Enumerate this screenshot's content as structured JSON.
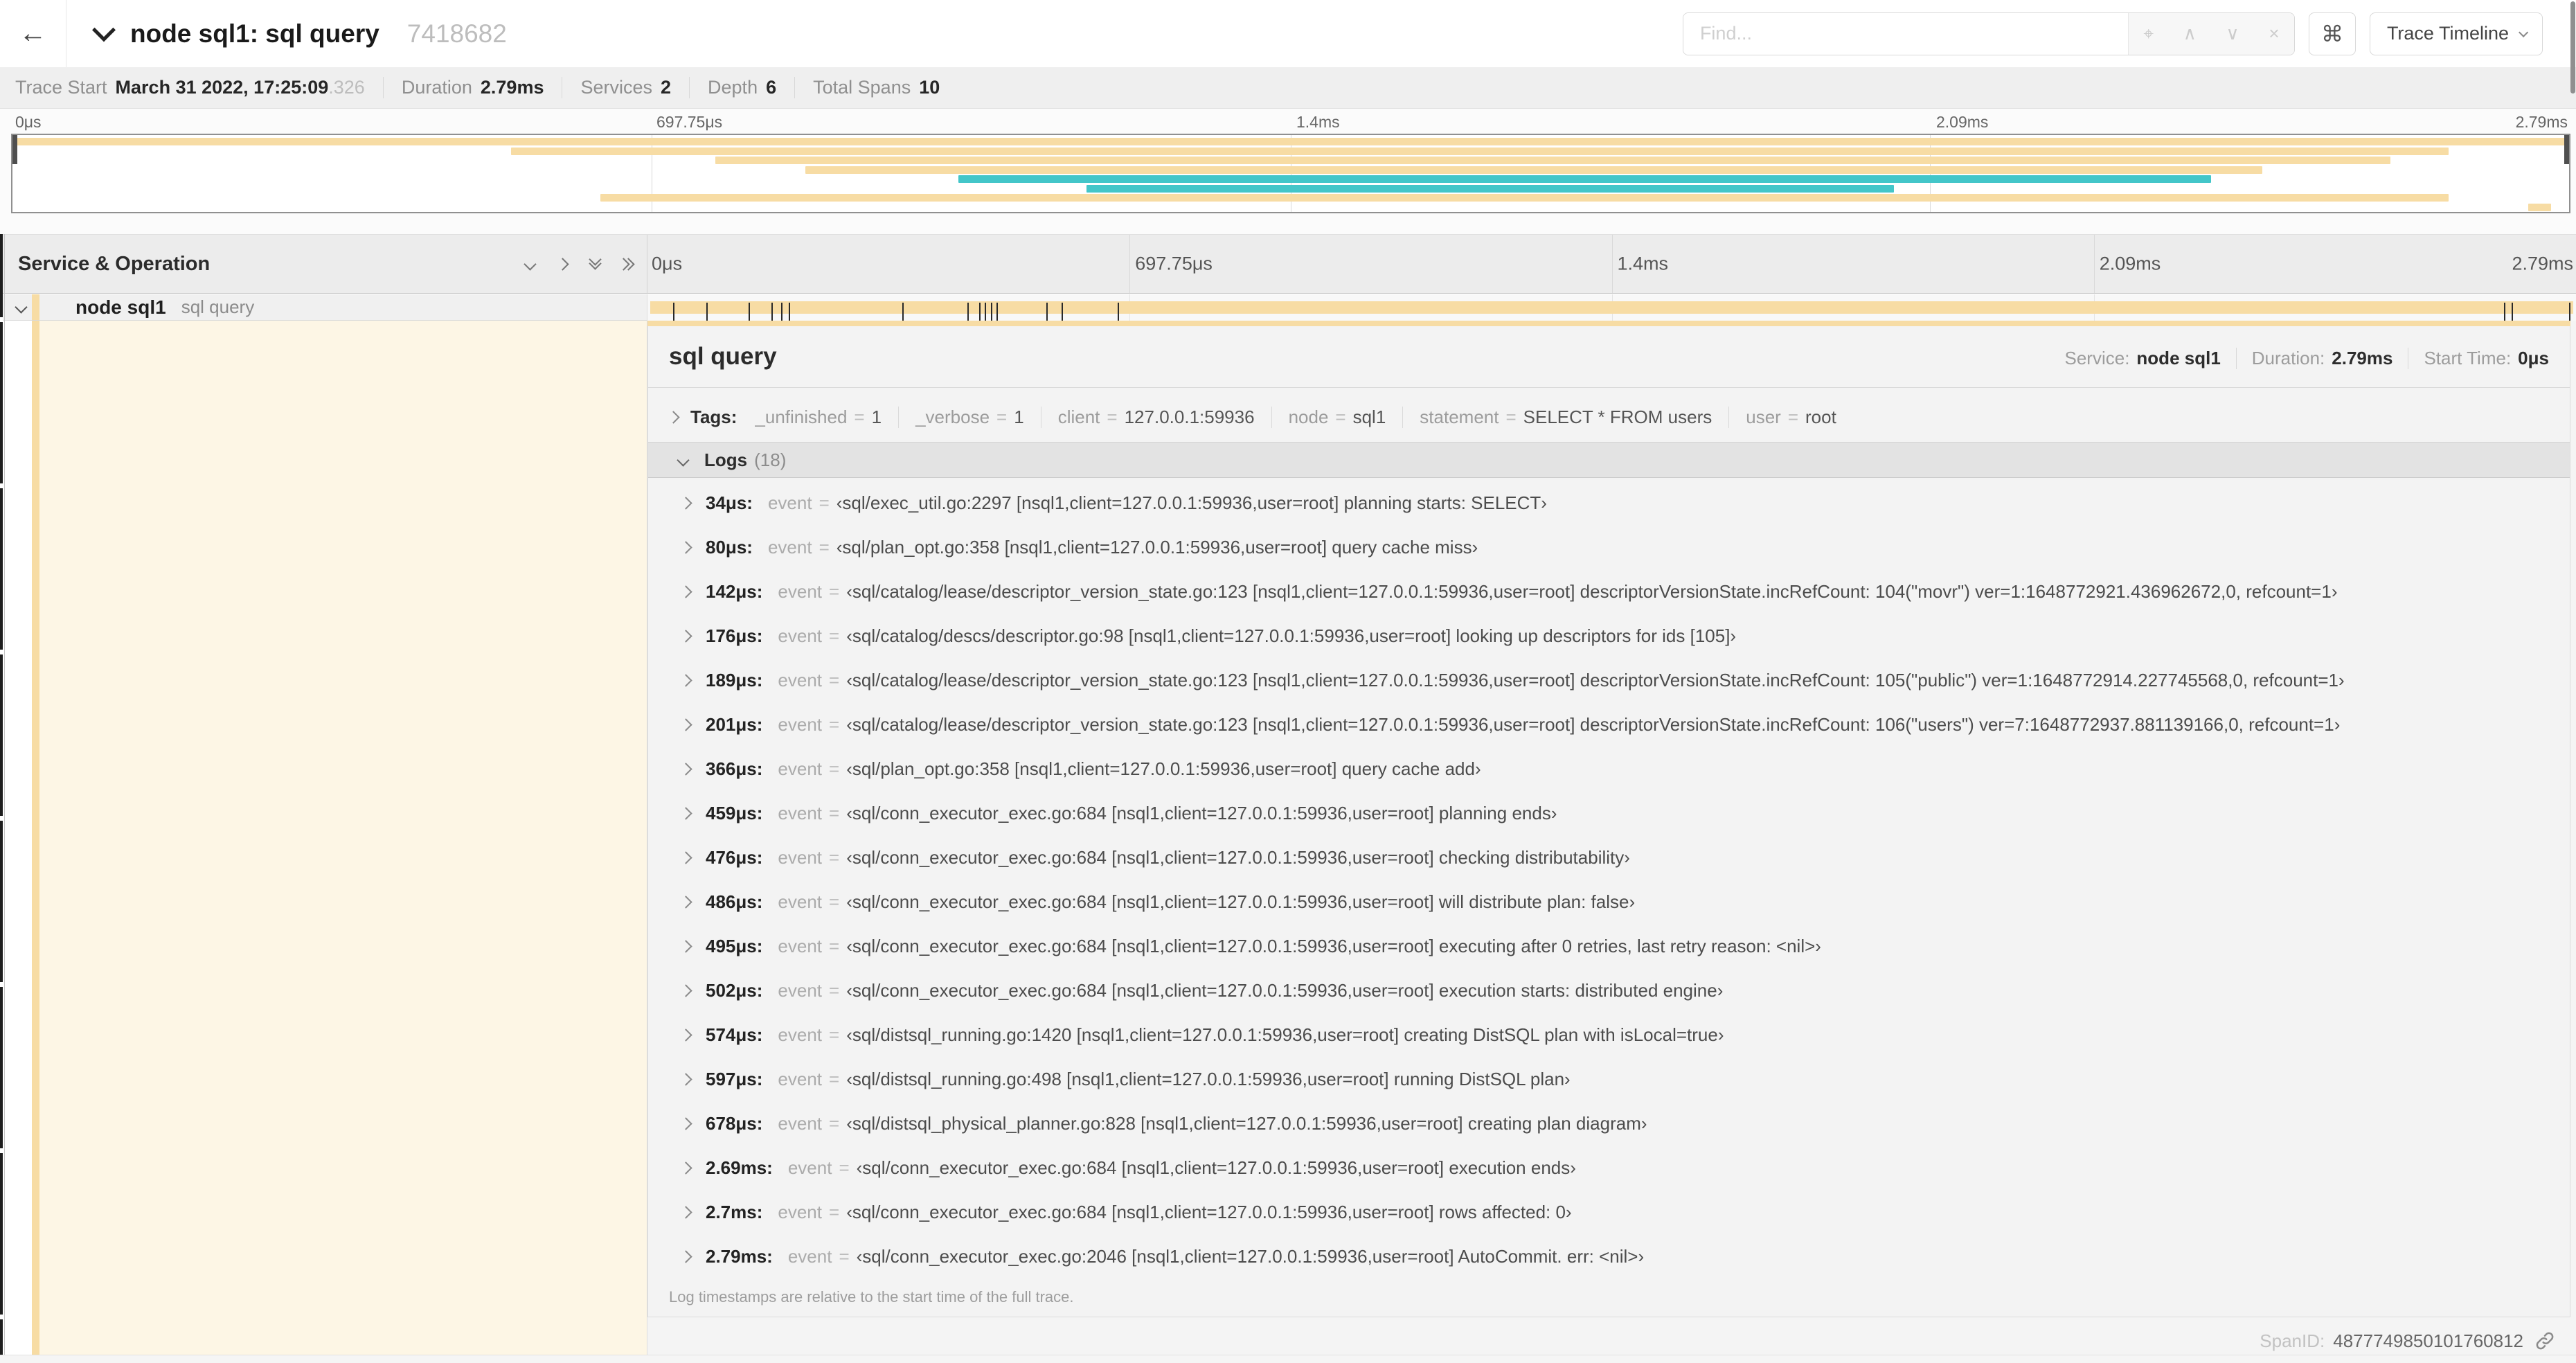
{
  "palette": {
    "tan": "#f7dca4",
    "teal": "#43c6c9",
    "cream": "#fdf6e5"
  },
  "header": {
    "back_arrow": "←",
    "title": "node sql1: sql query",
    "trace_id": "7418682",
    "find_placeholder": "Find...",
    "suffix_icons": {
      "target": "⌖",
      "prev": "∧",
      "next": "∨",
      "clear": "×"
    },
    "shortcut_icon": "⌘",
    "view_selector": "Trace Timeline"
  },
  "trace_stats": {
    "items": [
      {
        "label": "Trace Start",
        "value": "March 31 2022, 17:25:09",
        "suffix": ".326"
      },
      {
        "label": "Duration",
        "value": "2.79ms",
        "suffix": ""
      },
      {
        "label": "Services",
        "value": "2",
        "suffix": ""
      },
      {
        "label": "Depth",
        "value": "6",
        "suffix": ""
      },
      {
        "label": "Total Spans",
        "value": "10",
        "suffix": ""
      }
    ]
  },
  "minimap": {
    "ticks": [
      "0μs",
      "697.75μs",
      "1.4ms",
      "2.09ms",
      "2.79ms"
    ],
    "spans": [
      {
        "start": 0,
        "end": 100,
        "color": "tan"
      },
      {
        "start": 19.5,
        "end": 95.3,
        "color": "tan"
      },
      {
        "start": 27.5,
        "end": 93,
        "color": "tan"
      },
      {
        "start": 31,
        "end": 88,
        "color": "tan"
      },
      {
        "start": 37,
        "end": 86,
        "color": "teal"
      },
      {
        "start": 42,
        "end": 73.6,
        "color": "teal"
      },
      {
        "start": 23,
        "end": 95.3,
        "color": "tan"
      },
      {
        "start": 98.4,
        "end": 99.3,
        "color": "tan"
      }
    ]
  },
  "timeline": {
    "left_title": "Service & Operation",
    "ticks": [
      "0μs",
      "697.75μs",
      "1.4ms",
      "2.09ms",
      "2.79ms"
    ]
  },
  "span_row": {
    "service": "node sql1",
    "operation": "sql query"
  },
  "detail": {
    "title": "sql query",
    "overview": [
      {
        "label": "Service:",
        "value": "node sql1"
      },
      {
        "label": "Duration:",
        "value": "2.79ms"
      },
      {
        "label": "Start Time:",
        "value": "0μs"
      }
    ],
    "tags_label": "Tags:",
    "tag_eq": "=",
    "tags": [
      {
        "key": "_unfinished",
        "value": "1"
      },
      {
        "key": "_verbose",
        "value": "1"
      },
      {
        "key": "client",
        "value": "127.0.0.1:59936"
      },
      {
        "key": "node",
        "value": "sql1"
      },
      {
        "key": "statement",
        "value": "SELECT * FROM users"
      },
      {
        "key": "user",
        "value": "root"
      }
    ],
    "logs_label": "Logs",
    "logs_count": "(18)",
    "log_key": "event",
    "logs": [
      {
        "time": "34μs:",
        "pct": 1.2,
        "value": "‹sql/exec_util.go:2297 [nsql1,client=127.0.0.1:59936,user=root] planning starts: SELECT›"
      },
      {
        "time": "80μs:",
        "pct": 2.9,
        "value": "‹sql/plan_opt.go:358 [nsql1,client=127.0.0.1:59936,user=root] query cache miss›"
      },
      {
        "time": "142μs:",
        "pct": 5.1,
        "value": "‹sql/catalog/lease/descriptor_version_state.go:123 [nsql1,client=127.0.0.1:59936,user=root] descriptorVersionState.incRefCount: 104(\"movr\") ver=1:1648772921.436962672,0, refcount=1›"
      },
      {
        "time": "176μs:",
        "pct": 6.3,
        "value": "‹sql/catalog/descs/descriptor.go:98 [nsql1,client=127.0.0.1:59936,user=root] looking up descriptors for ids [105]›"
      },
      {
        "time": "189μs:",
        "pct": 6.8,
        "value": "‹sql/catalog/lease/descriptor_version_state.go:123 [nsql1,client=127.0.0.1:59936,user=root] descriptorVersionState.incRefCount: 105(\"public\") ver=1:1648772914.227745568,0, refcount=1›"
      },
      {
        "time": "201μs:",
        "pct": 7.2,
        "value": "‹sql/catalog/lease/descriptor_version_state.go:123 [nsql1,client=127.0.0.1:59936,user=root] descriptorVersionState.incRefCount: 106(\"users\") ver=7:1648772937.881139166,0, refcount=1›"
      },
      {
        "time": "366μs:",
        "pct": 13.1,
        "value": "‹sql/plan_opt.go:358 [nsql1,client=127.0.0.1:59936,user=root] query cache add›"
      },
      {
        "time": "459μs:",
        "pct": 16.5,
        "value": "‹sql/conn_executor_exec.go:684 [nsql1,client=127.0.0.1:59936,user=root] planning ends›"
      },
      {
        "time": "476μs:",
        "pct": 17.1,
        "value": "‹sql/conn_executor_exec.go:684 [nsql1,client=127.0.0.1:59936,user=root] checking distributability›"
      },
      {
        "time": "486μs:",
        "pct": 17.4,
        "value": "‹sql/conn_executor_exec.go:684 [nsql1,client=127.0.0.1:59936,user=root] will distribute plan: false›"
      },
      {
        "time": "495μs:",
        "pct": 17.7,
        "value": "‹sql/conn_executor_exec.go:684 [nsql1,client=127.0.0.1:59936,user=root] executing after 0 retries, last retry reason: <nil>›"
      },
      {
        "time": "502μs:",
        "pct": 18.0,
        "value": "‹sql/conn_executor_exec.go:684 [nsql1,client=127.0.0.1:59936,user=root] execution starts: distributed engine›"
      },
      {
        "time": "574μs:",
        "pct": 20.6,
        "value": "‹sql/distsql_running.go:1420 [nsql1,client=127.0.0.1:59936,user=root] creating DistSQL plan with isLocal=true›"
      },
      {
        "time": "597μs:",
        "pct": 21.4,
        "value": "‹sql/distsql_running.go:498 [nsql1,client=127.0.0.1:59936,user=root] running DistSQL plan›"
      },
      {
        "time": "678μs:",
        "pct": 24.3,
        "value": "‹sql/distsql_physical_planner.go:828 [nsql1,client=127.0.0.1:59936,user=root] creating plan diagram›"
      },
      {
        "time": "2.69ms:",
        "pct": 96.4,
        "value": "‹sql/conn_executor_exec.go:684 [nsql1,client=127.0.0.1:59936,user=root] execution ends›"
      },
      {
        "time": "2.7ms:",
        "pct": 96.8,
        "value": "‹sql/conn_executor_exec.go:684 [nsql1,client=127.0.0.1:59936,user=root] rows affected: 0›"
      },
      {
        "time": "2.79ms:",
        "pct": 99.8,
        "value": "‹sql/conn_executor_exec.go:2046 [nsql1,client=127.0.0.1:59936,user=root] AutoCommit. err: <nil>›"
      }
    ],
    "footer": "Log timestamps are relative to the start time of the full trace.",
    "spanid_label": "SpanID:",
    "spanid": "4877749850101760812"
  }
}
